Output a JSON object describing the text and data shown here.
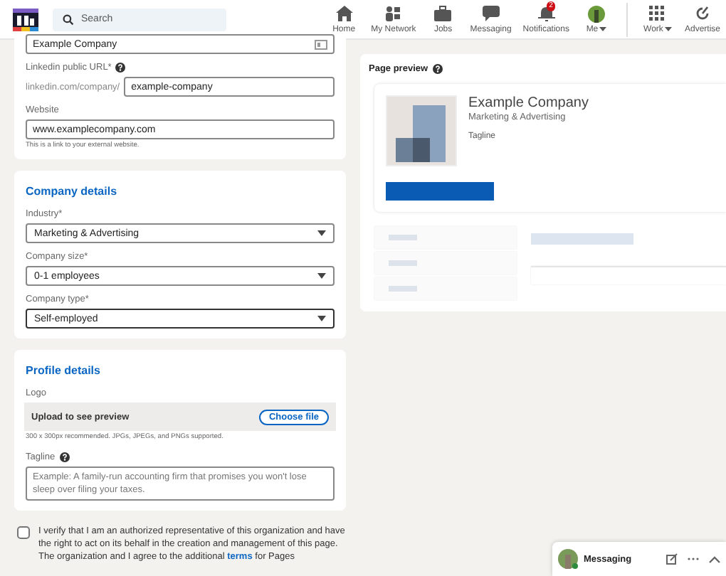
{
  "nav": {
    "search": {
      "placeholder": "Search"
    },
    "items": [
      {
        "label": "Home",
        "kind": "home"
      },
      {
        "label": "My Network",
        "kind": "network"
      },
      {
        "label": "Jobs",
        "kind": "jobs"
      },
      {
        "label": "Messaging",
        "kind": "messaging"
      },
      {
        "label": "Notifications",
        "kind": "bell",
        "badge": "2"
      },
      {
        "label": "Me",
        "kind": "me",
        "dropdown": true
      },
      {
        "label": "Work",
        "kind": "grid",
        "dropdown": true
      },
      {
        "label": "Advertise",
        "kind": "advertise"
      }
    ]
  },
  "page_info": {
    "name_value": "Example Company",
    "url_label": "Linkedin public URL*",
    "url_prefix": "linkedin.com/company/",
    "url_value": "example-company",
    "website_label": "Website",
    "website_value": "www.examplecompany.com",
    "website_hint": "This is a link to your external website."
  },
  "company_details": {
    "title": "Company details",
    "fields": [
      {
        "label": "Industry*",
        "value": "Marketing & Advertising",
        "focused": false
      },
      {
        "label": "Company size*",
        "value": "0-1 employees",
        "focused": false
      },
      {
        "label": "Company type*",
        "value": "Self-employed",
        "focused": true
      }
    ]
  },
  "profile_details": {
    "title": "Profile details",
    "logo_label": "Logo",
    "upload_text": "Upload to see preview",
    "choose_button": "Choose file",
    "logo_hint": "300 x 300px recommended. JPGs, JPEGs, and PNGs supported.",
    "tagline_label": "Tagline",
    "tagline_placeholder": "Example: A family-run accounting firm that promises you won't lose sleep over filing your taxes."
  },
  "verify": {
    "checked": false,
    "text": "I verify that I am an authorized representative of this organization and have the right to act on its behalf in the creation and management of this page. The organization and I agree to the additional ",
    "link": "terms",
    "tail": " for Pages"
  },
  "preview": {
    "title": "Page preview",
    "company": "Example Company",
    "industry": "Marketing & Advertising",
    "tagline": "Tagline"
  },
  "messaging": {
    "label": "Messaging"
  }
}
